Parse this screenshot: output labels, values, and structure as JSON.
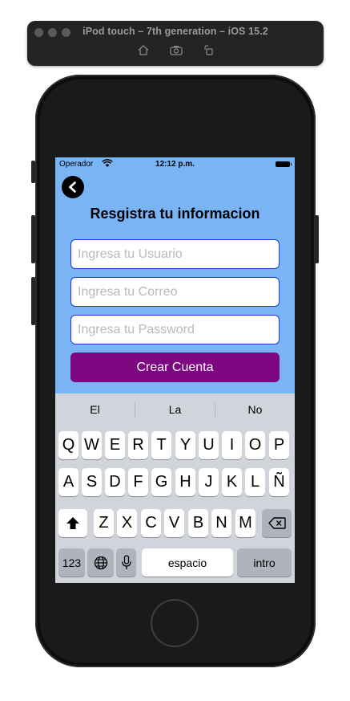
{
  "simulator": {
    "title": "iPod touch – 7th generation – iOS 15.2",
    "toolbar": [
      "home-icon",
      "screenshot-icon",
      "rotate-icon"
    ]
  },
  "status_bar": {
    "carrier": "Operador",
    "time": "12:12 p.m."
  },
  "form": {
    "title": "Resgistra tu informacion",
    "username_placeholder": "Ingresa tu Usuario",
    "email_placeholder": "Ingresa tu Correo",
    "password_placeholder": "Ingresa tu Password",
    "submit_label": "Crear Cuenta"
  },
  "keyboard": {
    "suggestions": [
      "El",
      "La",
      "No"
    ],
    "row1": [
      "Q",
      "W",
      "E",
      "R",
      "T",
      "Y",
      "U",
      "I",
      "O",
      "P"
    ],
    "row2": [
      "A",
      "S",
      "D",
      "F",
      "G",
      "H",
      "J",
      "K",
      "L",
      "Ñ"
    ],
    "row3": [
      "Z",
      "X",
      "C",
      "V",
      "B",
      "N",
      "M"
    ],
    "numbers_key": "123",
    "space_key": "espacio",
    "return_key": "intro"
  },
  "colors": {
    "screen_background": "#79b4f5",
    "field_border": "#2434d8",
    "submit_button": "#7c0780",
    "keyboard_background": "#d1d5db"
  }
}
